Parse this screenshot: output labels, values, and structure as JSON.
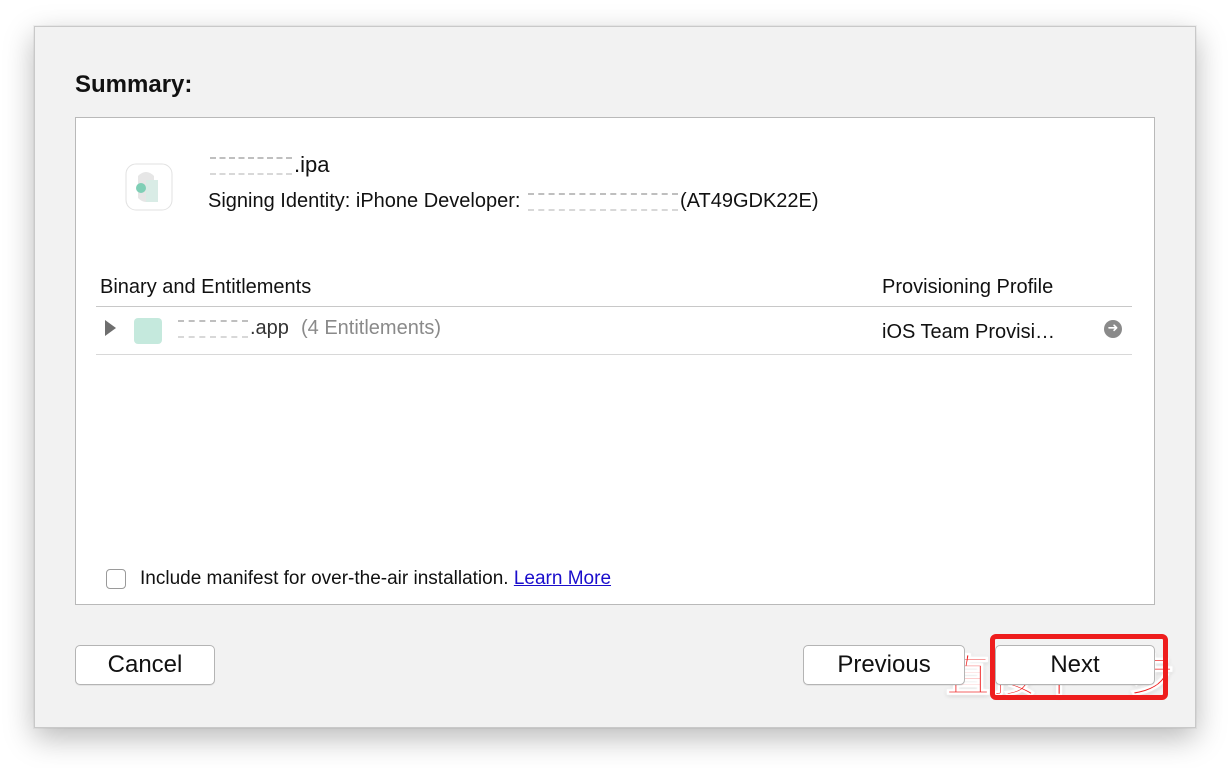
{
  "summary": {
    "heading": "Summary:",
    "ipa_name": ".ipa",
    "signing_prefix": "Signing Identity: iPhone Developer:",
    "signing_id": "(AT49GDK22E)"
  },
  "table": {
    "col_binary": "Binary and Entitlements",
    "col_profile": "Provisioning Profile",
    "row": {
      "app_name": ".app",
      "entitlements": "(4 Entitlements)",
      "profile": "iOS Team Provisi…"
    }
  },
  "manifest": {
    "label": "Include manifest for over-the-air installation.",
    "link": "Learn More",
    "checked": false
  },
  "annotation": "直接下一步",
  "buttons": {
    "cancel": "Cancel",
    "previous": "Previous",
    "next": "Next"
  },
  "colors": {
    "annotation": "#ee1d1d",
    "link": "#1a0dcc",
    "window_bg": "#f2f2f2"
  },
  "icons": {
    "app": "app-icon",
    "disclosure": "disclosure-triangle-icon",
    "goto": "arrow-right-circle-icon"
  }
}
